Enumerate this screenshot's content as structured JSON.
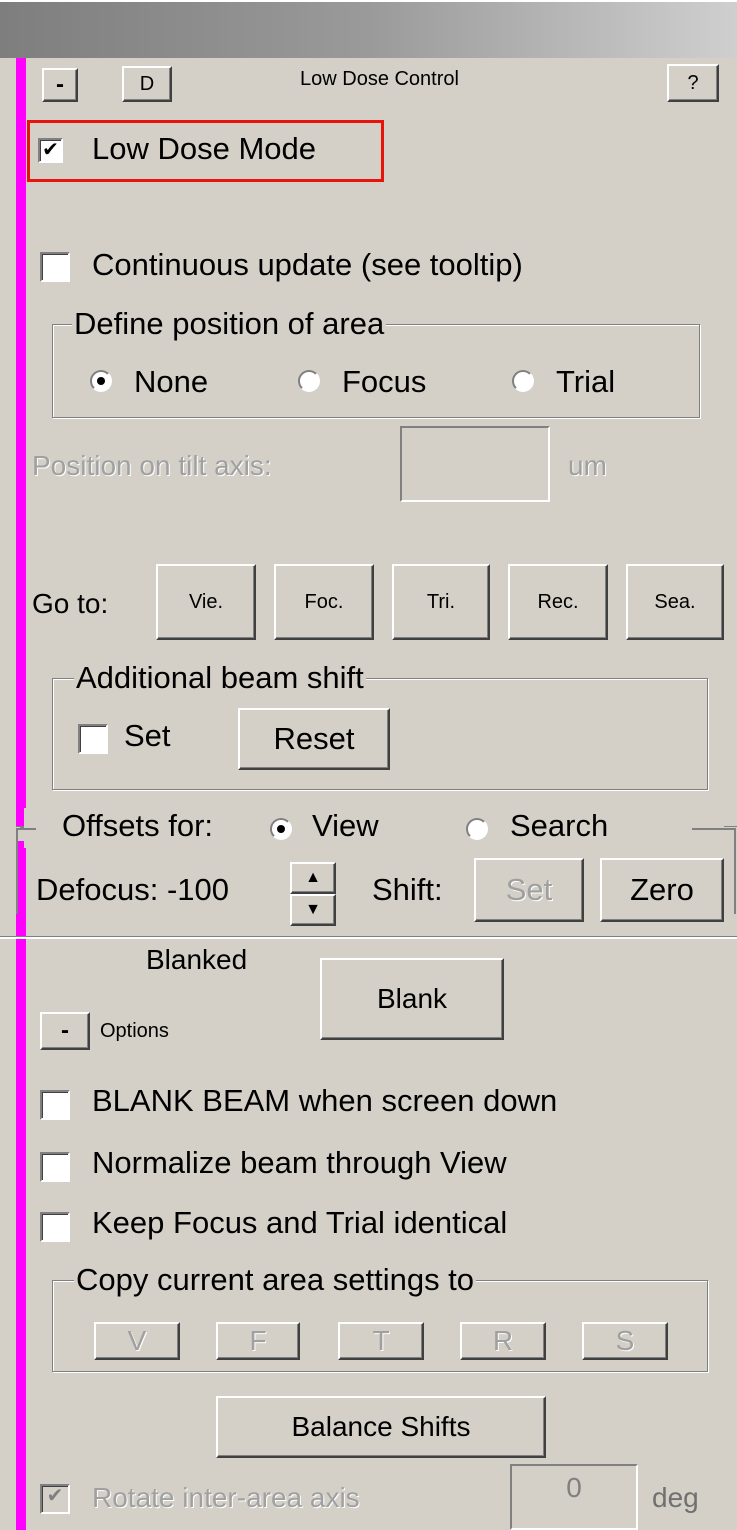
{
  "panel": {
    "title": "Low Dose Control",
    "collapse_label": "-",
    "d_label": "D",
    "help_label": "?"
  },
  "low_dose": {
    "mode_label": "Low Dose Mode",
    "mode_checked": "✔",
    "continuous_label": "Continuous update (see tooltip)"
  },
  "define_area": {
    "legend": "Define position of area",
    "options": [
      "None",
      "Focus",
      "Trial"
    ],
    "selected": "None"
  },
  "tilt_axis": {
    "label": "Position on tilt axis:",
    "value": "",
    "unit": "um"
  },
  "goto": {
    "label": "Go to:",
    "buttons": [
      "Vie.",
      "Foc.",
      "Tri.",
      "Rec.",
      "Sea."
    ]
  },
  "beam_shift": {
    "legend": "Additional beam shift",
    "set_label": "Set",
    "reset_label": "Reset"
  },
  "offsets": {
    "label": "Offsets for:",
    "options": [
      "View",
      "Search"
    ],
    "selected": "View",
    "defocus_label": "Defocus: -100",
    "shift_label": "Shift:",
    "set_label": "Set",
    "zero_label": "Zero"
  },
  "blank": {
    "status": "Blanked",
    "button_label": "Blank",
    "options_collapse": "-",
    "options_label": "Options"
  },
  "options": {
    "blank_beam_label": "BLANK BEAM when screen down",
    "normalize_label": "Normalize beam through View",
    "keep_focus_label": "Keep Focus and Trial identical"
  },
  "copy_settings": {
    "legend": "Copy current area settings to",
    "buttons": [
      "V",
      "F",
      "T",
      "R",
      "S"
    ]
  },
  "balance": {
    "label": "Balance Shifts"
  },
  "rotate": {
    "label": "Rotate inter-area axis",
    "checked": "✔",
    "value": "0",
    "unit": "deg"
  },
  "colors": {
    "panel_bg": "#d4d0c8",
    "accent_bar": "#ff00ff",
    "highlight_box": "#e8140c"
  }
}
